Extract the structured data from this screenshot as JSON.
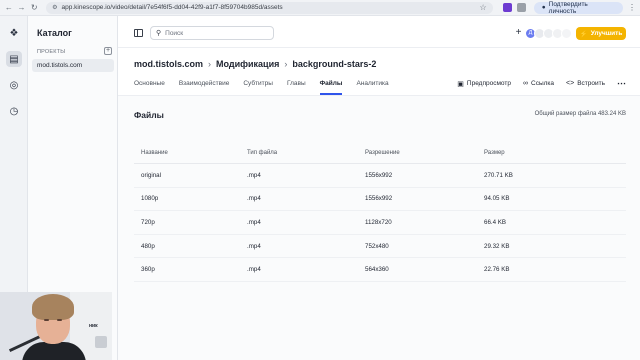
{
  "browser": {
    "url": "app.kinescope.io/video/detail/7e54f6f5-dd04-42f9-a1f7-8f59704b985d/assets",
    "verify_label": "Подтвердить личность"
  },
  "sidebar": {
    "title": "Каталог",
    "section_label": "ПРОЕКТЫ",
    "projects": [
      "mod.tistols.com"
    ]
  },
  "topbar": {
    "search_placeholder": "Поиск",
    "avatar_initial": "Д",
    "upgrade_label": "Улучшить"
  },
  "breadcrumb": [
    "mod.tistols.com",
    "Модификация",
    "background-stars-2"
  ],
  "tabs": [
    {
      "label": "Основные",
      "active": false
    },
    {
      "label": "Взаимодействие",
      "active": false
    },
    {
      "label": "Субтитры",
      "active": false
    },
    {
      "label": "Главы",
      "active": false
    },
    {
      "label": "Файлы",
      "active": true
    },
    {
      "label": "Аналитика",
      "active": false
    }
  ],
  "actions": {
    "preview": "Предпросмотр",
    "link": "Ссылка",
    "embed": "Встроить"
  },
  "files": {
    "title": "Файлы",
    "total": "Общий размер файла 483.24 KB",
    "columns": [
      "Название",
      "Тип файла",
      "Разрешение",
      "Размер"
    ],
    "rows": [
      [
        "original",
        ".mp4",
        "1556x992",
        "270.71 KB"
      ],
      [
        "1080p",
        ".mp4",
        "1556x992",
        "94.05 KB"
      ],
      [
        "720p",
        ".mp4",
        "1128x720",
        "66.4 KB"
      ],
      [
        "480p",
        ".mp4",
        "752x480",
        "29.32 KB"
      ],
      [
        "360p",
        ".mp4",
        "564x360",
        "22.76 KB"
      ]
    ]
  },
  "webcam": {
    "partial_label": "ник"
  },
  "colors": {
    "accent": "#2f54eb",
    "upgrade": "#f4b400"
  }
}
